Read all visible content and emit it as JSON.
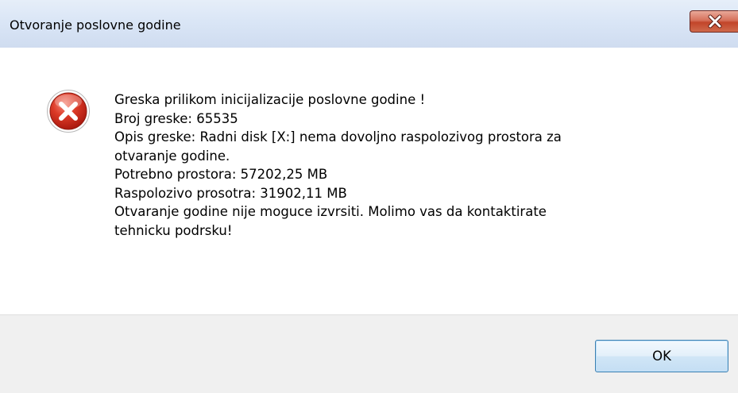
{
  "window": {
    "title": "Otvoranje poslovne godine",
    "close_icon": "close-icon"
  },
  "message": {
    "icon": "error-icon",
    "lines": [
      "Greska prilikom inicijalizacije poslovne godine !",
      "Broj greske: 65535",
      "Opis greske: Radni disk [X:] nema dovoljno raspolozivog prostora za",
      "otvaranje godine.",
      "Potrebno prostora: 57202,25 MB",
      "Raspolozivo prosotra: 31902,11 MB",
      "Otvaranje godine nije moguce izvrsiti. Molimo vas da kontaktirate",
      "tehnicku podrsku!"
    ]
  },
  "buttons": {
    "ok_label": "OK"
  },
  "colors": {
    "titlebar": "#dae6f6",
    "close_button": "#c2452a",
    "error_icon": "#d0281d",
    "footer": "#f0f0f0",
    "ok_border": "#3c7fb1"
  }
}
